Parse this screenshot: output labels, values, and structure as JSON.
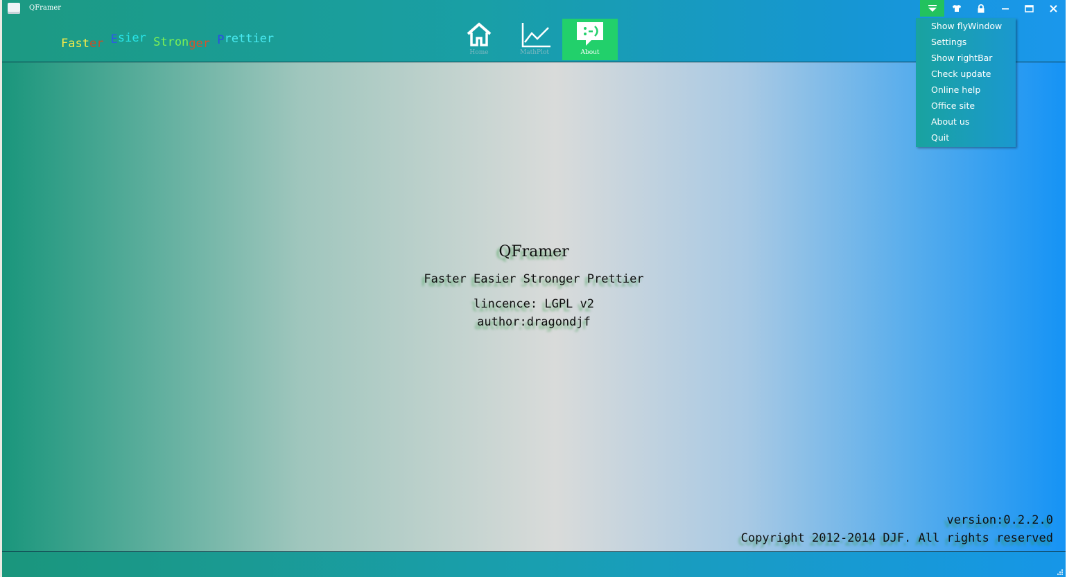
{
  "window": {
    "title": "QFramer"
  },
  "slogan": {
    "parts": [
      "Fast",
      "er",
      " E",
      "sier",
      " Stron",
      "ger",
      " P",
      "rettier"
    ]
  },
  "nav": {
    "tabs": [
      {
        "label": "Home",
        "icon": "home-icon",
        "active": false
      },
      {
        "label": "MathPlot",
        "icon": "line-chart-icon",
        "active": false
      },
      {
        "label": "About",
        "icon": "smiley-chat-icon",
        "active": true
      }
    ]
  },
  "window_buttons": [
    "menu-arrow-icon",
    "skin-shirt-icon",
    "lock-icon",
    "minimize-icon",
    "maximize-icon",
    "close-icon"
  ],
  "menu": {
    "items": [
      "Show flyWindow",
      "Settings",
      "Show rightBar",
      "Check update",
      "Online help",
      "Office site",
      "About us",
      "Quit"
    ]
  },
  "about": {
    "title": "QFramer",
    "tagline": "Faster Easier Stronger Prettier",
    "licence": "lincence: LGPL v2",
    "author": "author:dragondjf"
  },
  "footer": {
    "version": "version:0.2.2.0",
    "copyright": "Copyright 2012-2014 DJF. All rights reserved"
  },
  "colors": {
    "accent_green": "#22d06b",
    "menu_active": "#22c25e",
    "title_gradient_start": "#1c9a82",
    "title_gradient_end": "#1a97ec"
  }
}
